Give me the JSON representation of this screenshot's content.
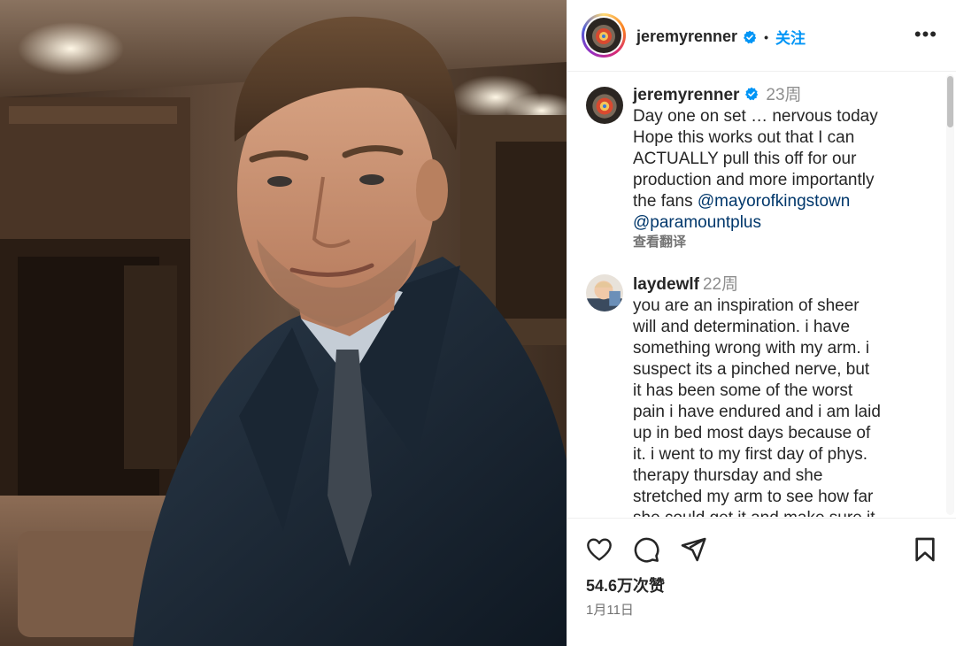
{
  "post": {
    "author": "jeremyrenner",
    "follow_label": "关注",
    "more_label": "•••",
    "separator": "•"
  },
  "caption": {
    "username": "jeremyrenner",
    "time": "23周",
    "text_line1": "Day one on set … nervous today",
    "text_line2": "Hope this works out that I can",
    "text_line3": "ACTUALLY pull this off for our",
    "text_line4": "production and more importantly",
    "text_line5_prefix": "the fans ",
    "mention1": "@mayorofkingstown",
    "mention2": "@paramountplus",
    "translate": "查看翻译"
  },
  "comment": {
    "username": "laydewlf",
    "time": "22周",
    "lines": [
      "you are an inspiration of sheer",
      "will and determination. i have",
      "something wrong with my arm. i",
      "suspect its a pinched nerve, but",
      "it has been some of the worst",
      "pain i have endured and i am laid",
      "up in bed most days because of",
      "it. i went to my first day of phys.",
      "therapy thursday and she",
      "stretched my arm to see how far",
      "she could get it and make sure it"
    ]
  },
  "footer": {
    "likes": "54.6万次赞",
    "date": "1月11日"
  },
  "icons": {
    "verified": "verified-badge-icon",
    "like": "heart-icon",
    "comment": "comment-icon",
    "share": "send-icon",
    "save": "bookmark-icon",
    "more": "more-options-icon"
  },
  "colors": {
    "accent": "#0095f6",
    "mention": "#00376b",
    "muted": "#8e8e8e"
  }
}
